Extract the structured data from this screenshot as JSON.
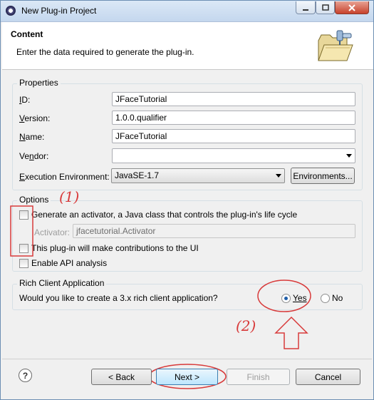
{
  "window": {
    "title": "New Plug-in Project"
  },
  "header": {
    "title": "Content",
    "description": "Enter the data required to generate the plug-in."
  },
  "properties": {
    "group_label": "Properties",
    "id_label": "ID:",
    "id_value": "JFaceTutorial",
    "version_label": "Version:",
    "version_value": "1.0.0.qualifier",
    "name_label": "Name:",
    "name_value": "JFaceTutorial",
    "vendor_label": "Vendor:",
    "vendor_value": "",
    "exec_env_label": "Execution Environment:",
    "exec_env_value": "JavaSE-1.7",
    "environments_button": "Environments..."
  },
  "options": {
    "group_label": "Options",
    "generate_activator_label": "Generate an activator, a Java class that controls the plug-in's life cycle",
    "generate_activator_checked": false,
    "activator_label": "Activator:",
    "activator_value": "jfacetutorial.Activator",
    "contributions_label": "This plug-in will make contributions to the UI",
    "contributions_checked": false,
    "api_analysis_label": "Enable API analysis",
    "api_analysis_checked": false
  },
  "rcp": {
    "group_label": "Rich Client Application",
    "question": "Would you like to create a 3.x rich client application?",
    "yes_label": "Yes",
    "no_label": "No",
    "selected": "Yes"
  },
  "annotations": {
    "marker_1": "(1)",
    "marker_2": "(2)",
    "color": "#d83a3a"
  },
  "footer": {
    "help_icon": "?",
    "back_button": "< Back",
    "next_button": "Next >",
    "finish_button": "Finish",
    "cancel_button": "Cancel"
  }
}
